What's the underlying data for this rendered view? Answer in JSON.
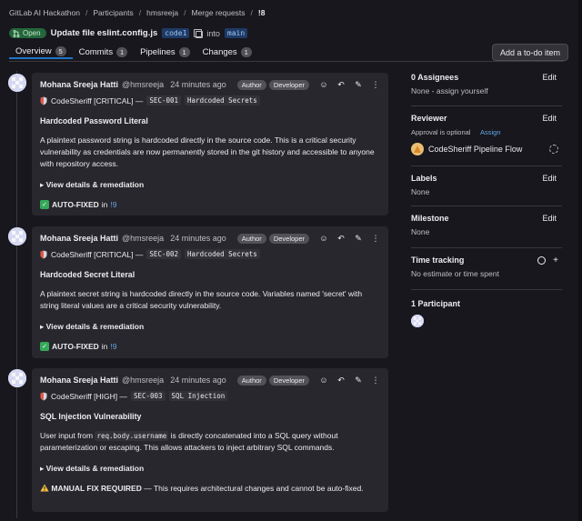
{
  "breadcrumb": [
    "GitLab AI Hackathon",
    "Participants",
    "hmsreeja",
    "Merge requests",
    "!8"
  ],
  "mr": {
    "status": "Open",
    "title": "Update file eslint.config.js",
    "source_branch": "code1",
    "into_label": "into",
    "target_branch": "main"
  },
  "tabs": [
    {
      "label": "Overview",
      "count": "5"
    },
    {
      "label": "Commits",
      "count": "1"
    },
    {
      "label": "Pipelines",
      "count": "1"
    },
    {
      "label": "Changes",
      "count": "1"
    }
  ],
  "todo_button": "Add a to-do item",
  "notes": [
    {
      "author": "Mohana Sreeja Hatti",
      "handle": "@hmsreeja",
      "time": "24 minutes ago",
      "roles": [
        "Author",
        "Developer"
      ],
      "tool": "CodeSheriff [CRITICAL] —",
      "id": "SEC-001",
      "category": "Hardcoded Secrets",
      "heading": "Hardcoded Password Literal",
      "body": "A plaintext password string is hardcoded directly in the source code. This is a critical security vulnerability as credentials are now permanently stored in the git history and accessible to anyone with repository access.",
      "details": "▸ View details & remediation",
      "status": "AUTO-FIXED",
      "status_in": "in",
      "status_link": "!9"
    },
    {
      "author": "Mohana Sreeja Hatti",
      "handle": "@hmsreeja",
      "time": "24 minutes ago",
      "roles": [
        "Author",
        "Developer"
      ],
      "tool": "CodeSheriff [CRITICAL] —",
      "id": "SEC-002",
      "category": "Hardcoded Secrets",
      "heading": "Hardcoded Secret Literal",
      "body": "A plaintext secret string is hardcoded directly in the source code. Variables named 'secret' with string literal values are a critical security vulnerability.",
      "details": "▸ View details & remediation",
      "status": "AUTO-FIXED",
      "status_in": "in",
      "status_link": "!9"
    },
    {
      "author": "Mohana Sreeja Hatti",
      "handle": "@hmsreeja",
      "time": "24 minutes ago",
      "roles": [
        "Author",
        "Developer"
      ],
      "tool": "CodeSheriff [HIGH] —",
      "id": "SEC-003",
      "category": "SQL Injection",
      "heading": "SQL Injection Vulnerability",
      "body_pre": "User input from",
      "body_code": "req.body.username",
      "body_post": "is directly concatenated into a SQL query without parameterization or escaping. This allows attackers to inject arbitrary SQL commands.",
      "details": "▸ View details & remediation",
      "manual": "MANUAL FIX REQUIRED",
      "manual_rest": "— This requires architectural changes and cannot be auto-fixed."
    }
  ],
  "sidebar": {
    "assignees_title": "0 Assignees",
    "assignees_value": "None - assign yourself",
    "reviewer_title": "Reviewer",
    "reviewer_note": "Approval is optional",
    "reviewer_assign": "Assign",
    "reviewer_name": "CodeSheriff Pipeline Flow",
    "labels_title": "Labels",
    "labels_value": "None",
    "milestone_title": "Milestone",
    "milestone_value": "None",
    "time_title": "Time tracking",
    "time_value": "No estimate or time spent",
    "participants_title": "1 Participant",
    "edit": "Edit"
  }
}
